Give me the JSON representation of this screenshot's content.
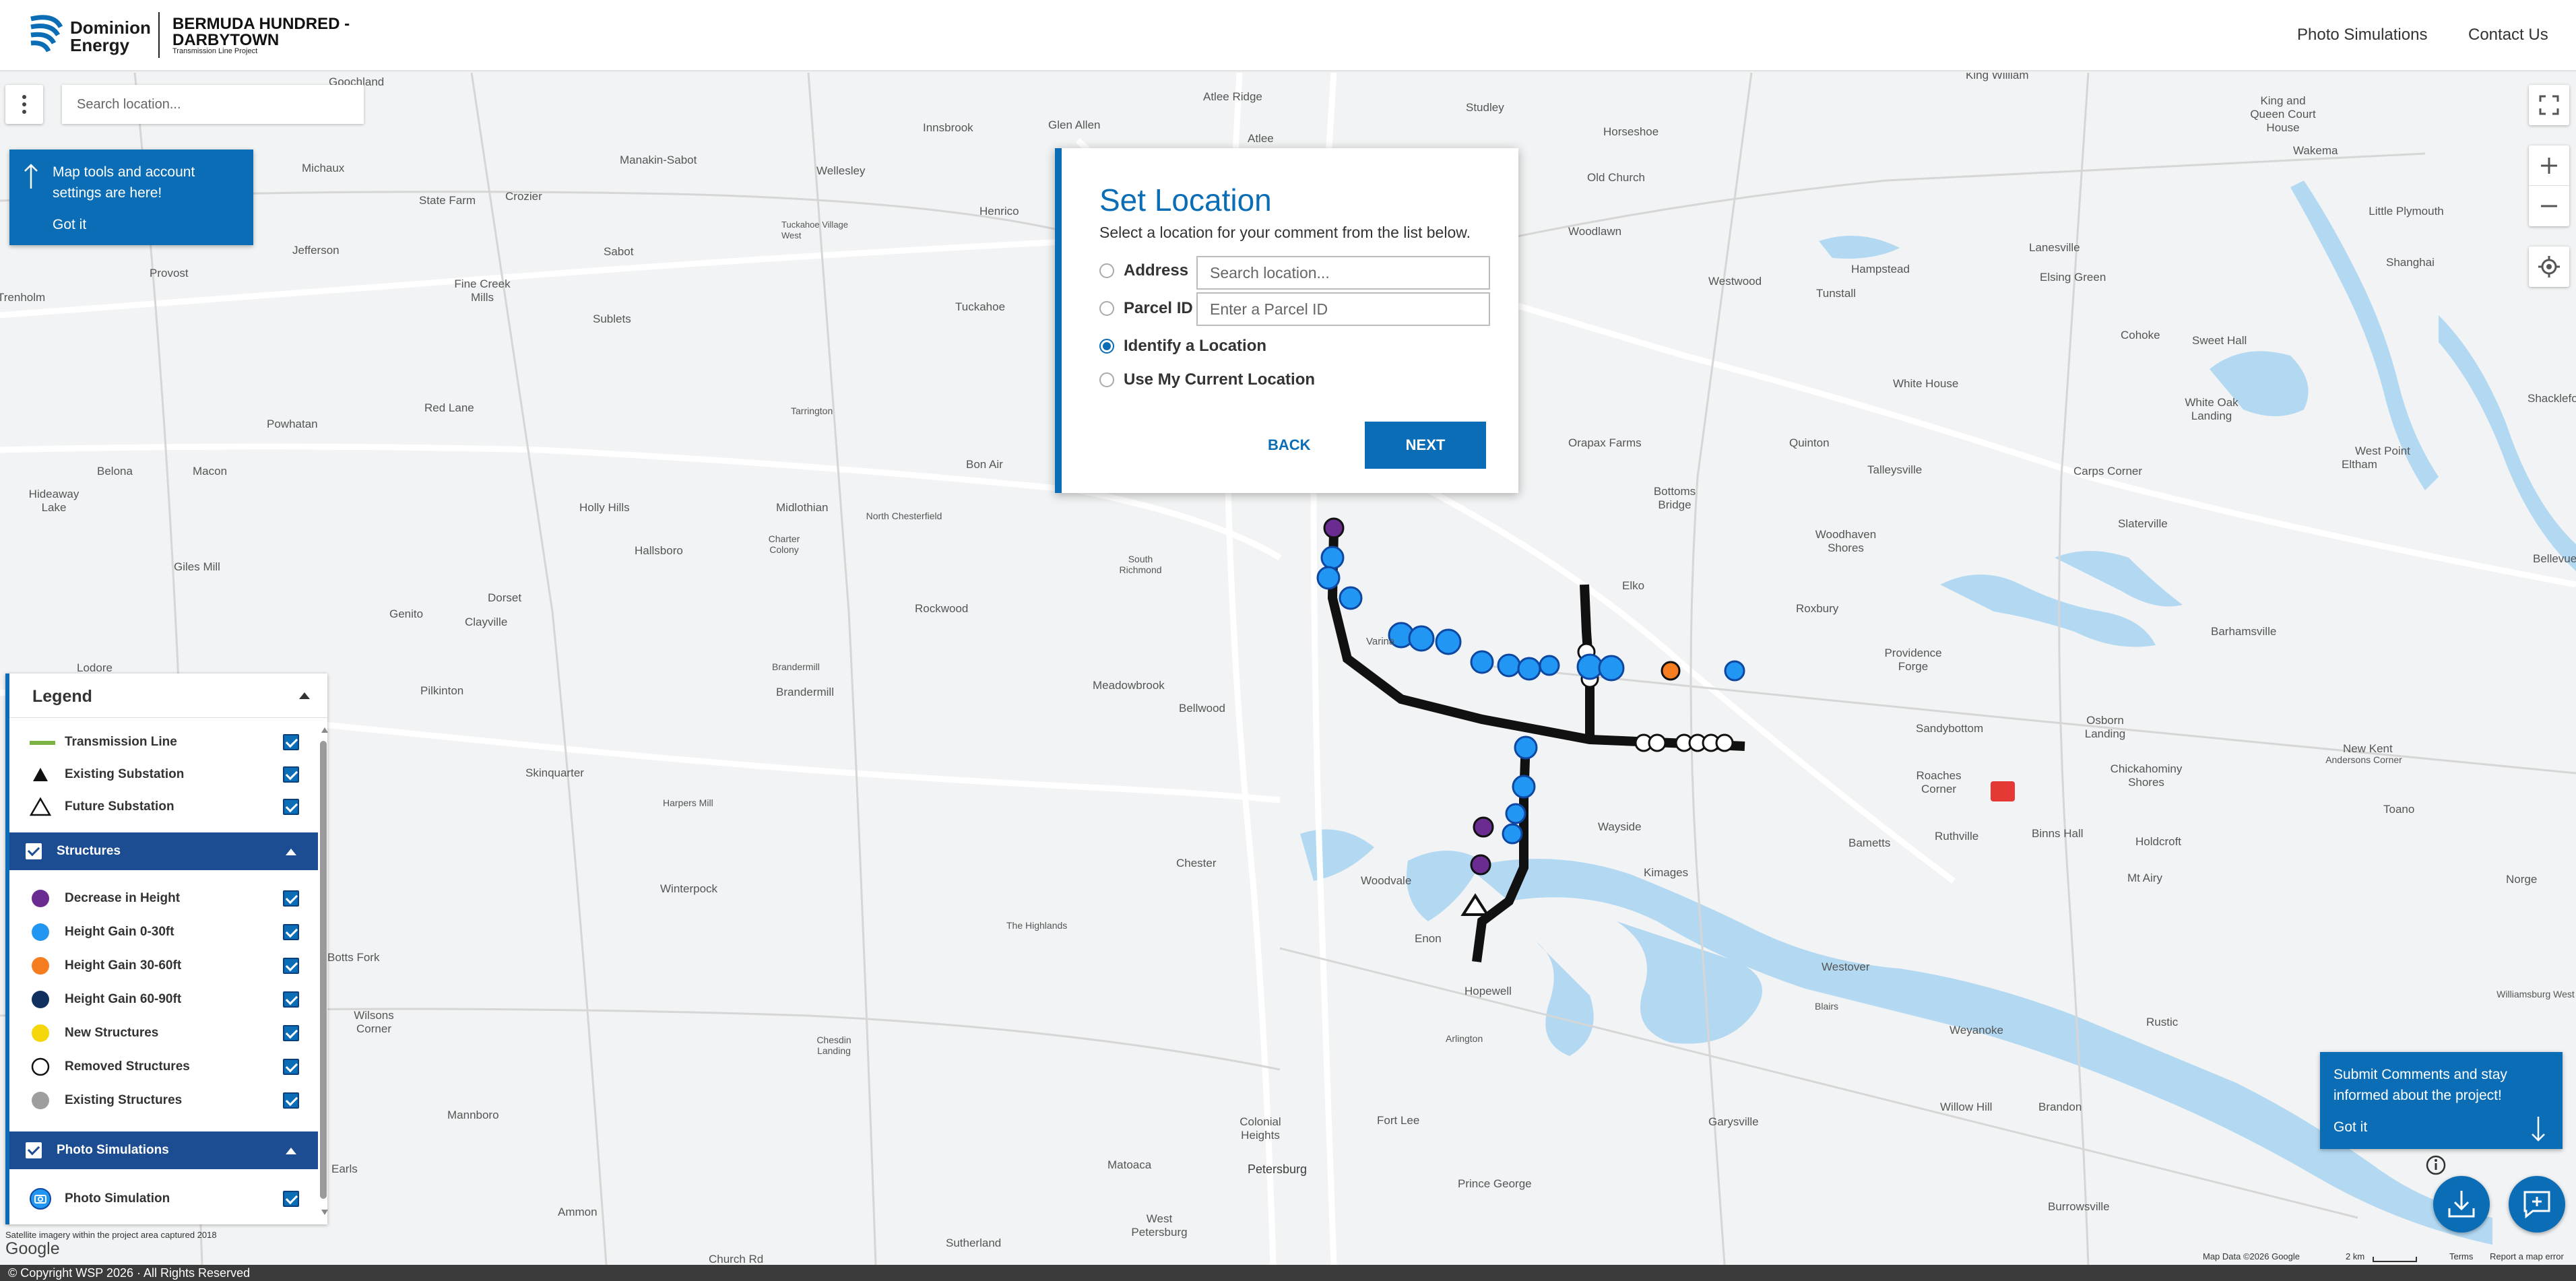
{
  "header": {
    "brand_line1": "Dominion",
    "brand_line2": "Energy",
    "project_title": "BERMUDA HUNDRED - DARBYTOWN",
    "project_subtitle": "Transmission Line Project",
    "nav": [
      "Photo Simulations",
      "Contact Us"
    ]
  },
  "map": {
    "search_placeholder": "Search location...",
    "tools_tip": {
      "text": "Map tools and account settings are here!",
      "got_it": "Got it"
    },
    "comments_tip": {
      "text": "Submit Comments and stay informed about the project!",
      "got_it": "Got it"
    },
    "satellite_note": "Satellite imagery within the project area captured 2018",
    "google_logo": "Google",
    "map_data": "Map Data ©2026 Google",
    "scale": "2 km",
    "terms": "Terms",
    "report": "Report a map error",
    "places": [
      "Goochland",
      "Atlee Ridge",
      "Studley",
      "King William",
      "King and Queen Court House",
      "Innsbrook",
      "Glen Allen",
      "Atlee",
      "Horseshoe",
      "Manakin-Sabot",
      "Wellesley",
      "Michaux",
      "Wakema",
      "State Farm",
      "Crozier",
      "Henrico",
      "Old Church",
      "Jefferson",
      "Tuckahoe Village West",
      "Woodlawn",
      "Little Plymouth",
      "Lanesville",
      "Sabot",
      "Hampstead",
      "Shanghai",
      "Provost",
      "Fine Creek Mills",
      "Tuckahoe",
      "Tunstall",
      "Elsing Green",
      "Trenholm",
      "Sublets",
      "Cohoke",
      "Sweet Hall",
      "Westwood",
      "White House",
      "Powhatan",
      "Tarrington",
      "White Oak Landing",
      "Red Lane",
      "Shackleford",
      "Bon Air",
      "Orapax Farms",
      "Quinton",
      "West Point",
      "Belona",
      "Macon",
      "Talleysville",
      "Carps Corner",
      "Eltham",
      "Hideaway Lake",
      "Midlothian",
      "North Chesterfield",
      "Bottoms Bridge",
      "Holly Hills",
      "Charter Colony",
      "Woodhaven Shores",
      "Slaterville",
      "Hallsboro",
      "South Richmond",
      "Giles Mill",
      "Elko",
      "Bellevue",
      "Dorset",
      "Rockwood",
      "Genito",
      "Clayville",
      "Roxbury",
      "Barhamsville",
      "Lodore",
      "Brandermill",
      "Meadowbrook",
      "Providence Forge",
      "Pilkinton",
      "Bellwood",
      "Brandermill",
      "Sandybottom",
      "Osborn Landing",
      "Skinquarter",
      "Chickahominy Shores",
      "New Kent",
      "Harpers Mill",
      "Roaches Corner",
      "Andersons Corner",
      "Ruthville",
      "Binns Hall",
      "Holdcroft",
      "Toano",
      "Winterpock",
      "Chester",
      "Wayside",
      "Bametts",
      "Mt Airy",
      "Norge",
      "Woodvale",
      "Kimages",
      "The Highlands",
      "Enon",
      "Westover",
      "Wilsons Corner",
      "Hopewell",
      "Blairs",
      "Weyanoke",
      "Rustic",
      "Williamsburg West",
      "Chesdin Landing",
      "Arlington",
      "Mannboro",
      "Colonial Heights",
      "Fort Lee",
      "Garysville",
      "Willow Hill",
      "Brandon",
      "Earls",
      "Matoaca",
      "Petersburg",
      "Prince George",
      "Burrowsville",
      "Ammon",
      "West Petersburg",
      "Sutherland",
      "Church Rd",
      "Varina",
      "Botts Fork"
    ]
  },
  "modal": {
    "title": "Set Location",
    "description": "Select a location for your comment from the list below.",
    "options": [
      "Address",
      "Parcel ID",
      "Identify a Location",
      "Use My Current Location"
    ],
    "address_placeholder": "Search location...",
    "parcel_placeholder": "Enter a Parcel ID",
    "selected": "Identify a Location",
    "back": "BACK",
    "next": "NEXT"
  },
  "legend": {
    "title": "Legend",
    "items": [
      "Transmission Line",
      "Existing Substation",
      "Future Substation"
    ],
    "structures_title": "Structures",
    "structures": [
      "Decrease in Height",
      "Height Gain 0-30ft",
      "Height Gain 30-60ft",
      "Height Gain 60-90ft",
      "New Structures",
      "Removed Structures",
      "Existing Structures"
    ],
    "photo_title": "Photo Simulations",
    "photo_items": [
      "Photo Simulation"
    ],
    "colors": {
      "transmission_line": "#7cb342",
      "decrease": "#6a2c91",
      "gain_0_30": "#2196f3",
      "gain_30_60": "#f57c1f",
      "gain_60_90": "#12305f",
      "new": "#f5d60a",
      "removed": "#ffffff",
      "existing": "#9e9e9e",
      "accent": "#0b6db5"
    }
  },
  "footer": {
    "copyright": "© Copyright WSP 2026 · All Rights Reserved"
  }
}
